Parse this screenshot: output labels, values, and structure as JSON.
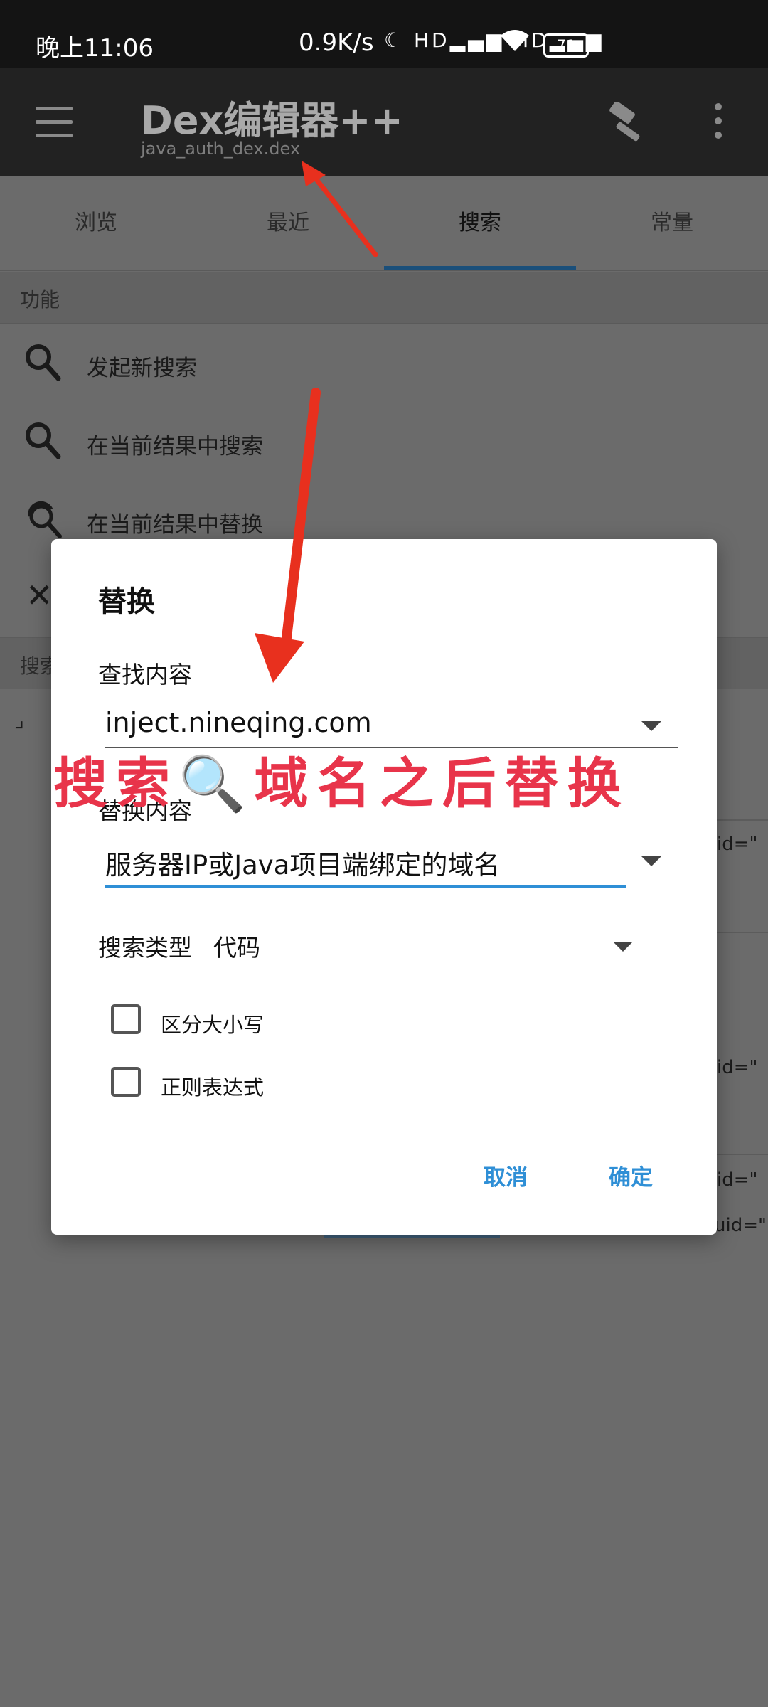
{
  "status_bar": {
    "time": "晚上11:06",
    "speed": "0.9K/s",
    "network_icons": "☾ HD▂▄▆ HD▂▄▆",
    "battery": "71"
  },
  "app_bar": {
    "title": "Dex编辑器++",
    "subtitle": "java_auth_dex.dex",
    "icons": [
      "menu-icon",
      "hammer-icon",
      "more-vert-icon"
    ]
  },
  "tabs": [
    {
      "label": "浏览"
    },
    {
      "label": "最近"
    },
    {
      "label": "搜索",
      "active": true
    },
    {
      "label": "常量"
    }
  ],
  "functions": {
    "header": "功能",
    "items": [
      {
        "label": "发起新搜索",
        "icon": "search-icon"
      },
      {
        "label": "在当前结果中搜索",
        "icon": "search-icon"
      },
      {
        "label": "在当前结果中替换",
        "icon": "replace-icon"
      }
    ]
  },
  "background_fragments": {
    "close_glyph": "✕",
    "search_head": "搜索",
    "bracket": "⌟",
    "id_text_1": "id=\"",
    "id_text_2": "id=\"",
    "id_text_3": "id=\"",
    "uid_text": "uid=\""
  },
  "dialog": {
    "title": "替换",
    "find_label": "查找内容",
    "find_value": "inject.nineqing.com",
    "replace_label": "替换内容",
    "replace_value": "服务器IP或Java项目端绑定的域名",
    "search_type_label": "搜索类型",
    "search_type_value": "代码",
    "case_label": "区分大小写",
    "regex_label": "正则表达式",
    "cancel_label": "取消",
    "ok_label": "确定"
  },
  "annotation": {
    "text": "搜索🔍域名之后替换",
    "color": "#e8344a"
  },
  "colors": {
    "accent": "#2f8fd6",
    "arrow": "#e8301e"
  }
}
